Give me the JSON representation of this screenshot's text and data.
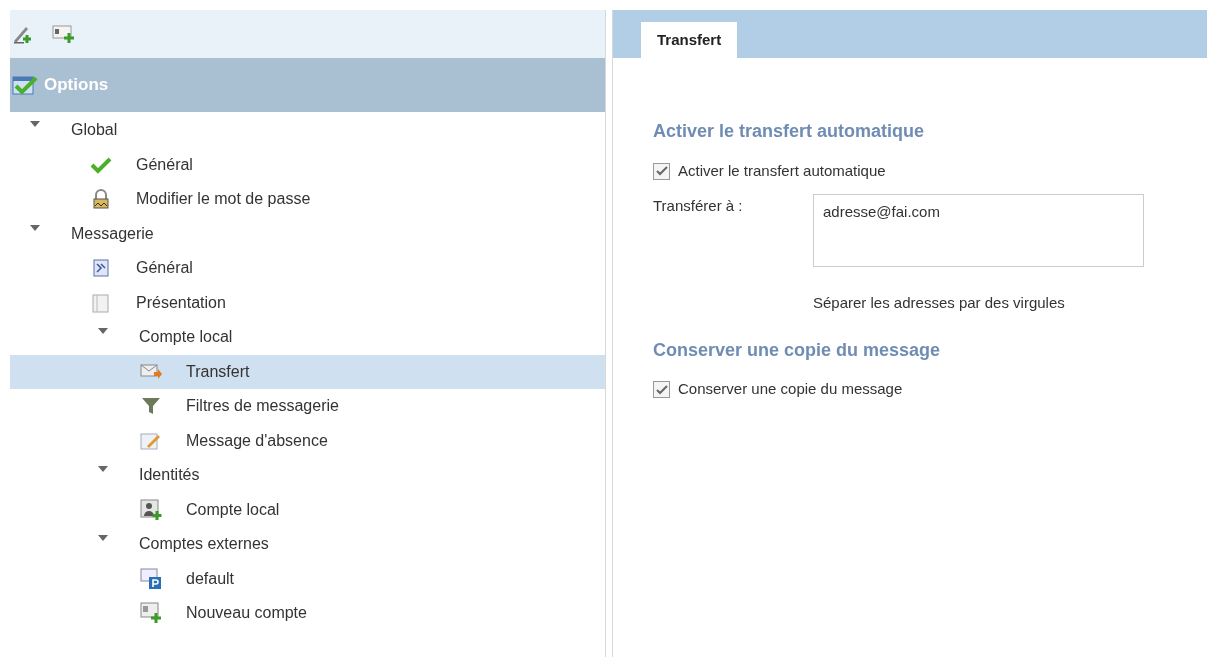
{
  "panel_title": "Options",
  "tree": [
    {
      "label": "Global",
      "expanded": true,
      "selected": false,
      "children": [
        {
          "label": "Général",
          "selected": false
        },
        {
          "label": "Modifier le mot de passe",
          "selected": false
        }
      ]
    },
    {
      "label": "Messagerie",
      "expanded": true,
      "selected": false,
      "children": [
        {
          "label": "Général",
          "selected": false
        },
        {
          "label": "Présentation",
          "selected": false
        },
        {
          "label": "Compte local",
          "expanded": true,
          "selected": false,
          "children": [
            {
              "label": "Transfert",
              "selected": true
            },
            {
              "label": "Filtres de messagerie",
              "selected": false
            },
            {
              "label": "Message d'absence",
              "selected": false
            }
          ]
        },
        {
          "label": "Identités",
          "expanded": true,
          "selected": false,
          "children": [
            {
              "label": "Compte local",
              "selected": false
            }
          ]
        },
        {
          "label": "Comptes externes",
          "expanded": true,
          "selected": false,
          "children": [
            {
              "label": "default",
              "selected": false
            },
            {
              "label": "Nouveau compte",
              "selected": false
            }
          ]
        }
      ]
    }
  ],
  "tabs": [
    {
      "label": "Transfert",
      "selected": true
    }
  ],
  "sections": [
    {
      "heading": "Activer le transfert automatique",
      "checkbox": {
        "label": "Activer le transfert automatique",
        "checked": true
      },
      "field": {
        "label": "Transférer à :",
        "value": "adresse@fai.com",
        "hint": "Séparer les adresses par des virgules"
      }
    },
    {
      "heading": "Conserver une copie du message",
      "checkbox": {
        "label": "Conserver une copie du message",
        "checked": true
      }
    }
  ]
}
